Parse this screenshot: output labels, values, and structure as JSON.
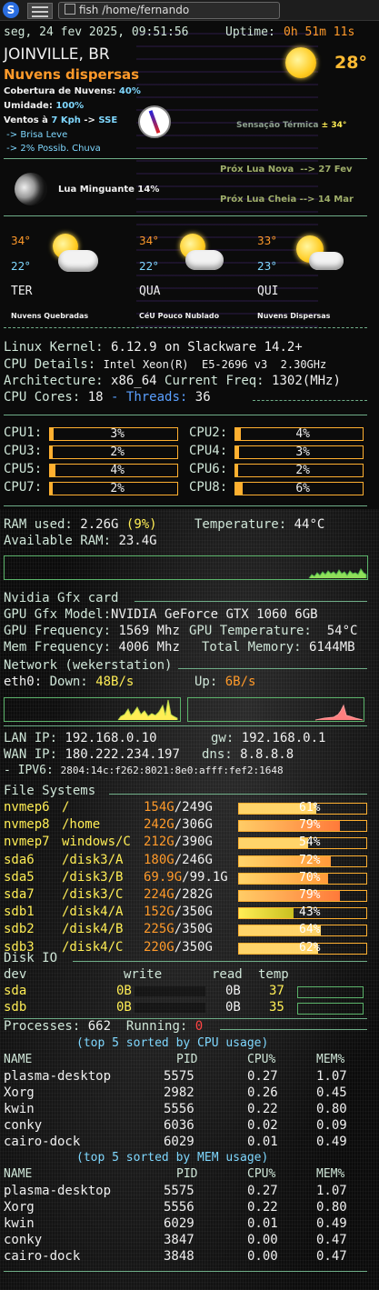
{
  "taskbar": {
    "logo_letter": "S",
    "window_title": "fish /home/fernando"
  },
  "header": {
    "datetime": "seg, 24 fev 2025, 09:51:56",
    "uptime_label": "Uptime:",
    "uptime_value": "0h 51m 11s"
  },
  "weather": {
    "city": "JOINVILLE, BR",
    "temp_now": "28°",
    "condition": "Nuvens dispersas",
    "cloud_label": "Cobertura de Nuvens:",
    "cloud_value": "40%",
    "humidity_label": "Umidade:",
    "humidity_value": "100%",
    "wind_label": "Ventos à",
    "wind_speed": "7 Kph",
    "wind_arrow": "->",
    "wind_dir": "SSE",
    "breeze": " -> Brisa Leve",
    "rain": " -> 2% Possib. Chuva",
    "feels_label": "Sensação Térmica",
    "feels_value": "± 34°",
    "moon_phase": "Lua Minguante 14%",
    "new_moon": "Próx Lua Nova  --> 27 Fev",
    "full_moon": "Próx Lua Cheia --> 14 Mar",
    "forecast": [
      {
        "high": "34°",
        "low": "22°",
        "day": "TER",
        "desc": "Nuvens Quebradas"
      },
      {
        "high": "34°",
        "low": "22°",
        "day": "QUA",
        "desc": "CéU Pouco Nublado"
      },
      {
        "high": "33°",
        "low": "23°",
        "day": "QUI",
        "desc": "Nuvens Dispersas"
      }
    ]
  },
  "system": {
    "kernel_label": "Linux Kernel:",
    "kernel_value": "6.12.9 on Slackware 14.2+",
    "cpu_label": "CPU Details:",
    "cpu_value": "Intel Xeon(R)  E5-2696 v3  2.30GHz",
    "arch_label": "Architecture:",
    "arch_value": "x86_64",
    "freq_label": "Current Freq:",
    "freq_value": "1302(MHz)",
    "cores_label": "CPU Cores:",
    "cores_value": "18",
    "threads_sep": "- Threads:",
    "threads_value": "36"
  },
  "cpus": [
    {
      "name": "CPU1:",
      "pct": 3
    },
    {
      "name": "CPU2:",
      "pct": 4
    },
    {
      "name": "CPU3:",
      "pct": 2
    },
    {
      "name": "CPU4:",
      "pct": 3
    },
    {
      "name": "CPU5:",
      "pct": 4
    },
    {
      "name": "CPU6:",
      "pct": 2
    },
    {
      "name": "CPU7:",
      "pct": 2
    },
    {
      "name": "CPU8:",
      "pct": 6
    }
  ],
  "memory": {
    "ram_label": "RAM used:",
    "ram_value": "2.26G",
    "ram_pct": "(9%)",
    "temp_label": "Temperature:",
    "temp_value": "44°C",
    "avail_label": "Available RAM:",
    "avail_value": "23.4G"
  },
  "gpu": {
    "title": "Nvidia Gfx card",
    "model_label": "GPU Gfx Model:",
    "model_value": "NVIDIA GeForce GTX 1060 6GB",
    "freq_label": "GPU Frequency:",
    "freq_value": "1569 Mhz",
    "temp_label": "GPU Temperature:",
    "temp_value": "54°C",
    "mem_label": "Mem Frequency:",
    "mem_value": "4006 Mhz",
    "total_label": "Total Memory:",
    "total_value": "6144MB"
  },
  "network": {
    "title": "Network (wekerstation)",
    "iface": "eth0:",
    "down_label": "Down:",
    "down_value": "48B/s",
    "up_label": "Up:",
    "up_value": "6B/s",
    "lan_label": "LAN IP:",
    "lan_value": "192.168.0.10",
    "gw_label": "gw:",
    "gw_value": "192.168.0.1",
    "wan_label": "WAN IP:",
    "wan_value": "180.222.234.197",
    "dns_label": "dns:",
    "dns_value": "8.8.8.8",
    "ipv6_label": "- IPV6:",
    "ipv6_value": "2804:14c:f262:8021:8e0:afff:fef2:1648"
  },
  "filesystems": {
    "title": "File Systems",
    "rows": [
      {
        "dev": "nvmep6",
        "mount": "/",
        "used": "154G",
        "size": "249G",
        "pct": 61
      },
      {
        "dev": "nvmep8",
        "mount": "/home",
        "used": "242G",
        "size": "306G",
        "pct": 79
      },
      {
        "dev": "nvmep7",
        "mount": "windows/C",
        "used": "212G",
        "size": "390G",
        "pct": 54
      },
      {
        "dev": "sda6",
        "mount": "/disk3/A",
        "used": "180G",
        "size": "246G",
        "pct": 72
      },
      {
        "dev": "sda5",
        "mount": "/disk3/B",
        "used": "69.9G",
        "size": "99.1G",
        "pct": 70
      },
      {
        "dev": "sda7",
        "mount": "/disk3/C",
        "used": "224G",
        "size": "282G",
        "pct": 79
      },
      {
        "dev": "sdb1",
        "mount": "/disk4/A",
        "used": "152G",
        "size": "350G",
        "pct": 43
      },
      {
        "dev": "sdb2",
        "mount": "/disk4/B",
        "used": "225G",
        "size": "350G",
        "pct": 64
      },
      {
        "dev": "sdb3",
        "mount": "/disk4/C",
        "used": "220G",
        "size": "350G",
        "pct": 62
      }
    ]
  },
  "diskio": {
    "title": "Disk IO",
    "headers": {
      "dev": "dev",
      "write": "write",
      "read": "read",
      "temp": "temp"
    },
    "rows": [
      {
        "dev": "sda",
        "write": "0B",
        "read": "0B",
        "temp": "37"
      },
      {
        "dev": "sdb",
        "write": "0B",
        "read": "0B",
        "temp": "35"
      }
    ]
  },
  "processes": {
    "proc_label": "Processes:",
    "proc_value": "662",
    "running_label": "Running:",
    "running_value": "0",
    "cpu_title": "(top 5 sorted by CPU usage)",
    "mem_title": "(top 5 sorted by MEM usage)",
    "headers": {
      "name": "NAME",
      "pid": "PID",
      "cpu": "CPU%",
      "mem": "MEM%"
    },
    "by_cpu": [
      {
        "name": "plasma-desktop",
        "pid": "5575",
        "cpu": "0.27",
        "mem": "1.07"
      },
      {
        "name": "Xorg",
        "pid": "2982",
        "cpu": "0.26",
        "mem": "0.45"
      },
      {
        "name": "kwin",
        "pid": "5556",
        "cpu": "0.22",
        "mem": "0.80"
      },
      {
        "name": "conky",
        "pid": "6036",
        "cpu": "0.02",
        "mem": "0.09"
      },
      {
        "name": "cairo-dock",
        "pid": "6029",
        "cpu": "0.01",
        "mem": "0.49"
      }
    ],
    "by_mem": [
      {
        "name": "plasma-desktop",
        "pid": "5575",
        "cpu": "0.27",
        "mem": "1.07"
      },
      {
        "name": "Xorg",
        "pid": "5556",
        "cpu": "0.22",
        "mem": "0.80"
      },
      {
        "name": "kwin",
        "pid": "6029",
        "cpu": "0.01",
        "mem": "0.49"
      },
      {
        "name": "conky",
        "pid": "3847",
        "cpu": "0.00",
        "mem": "0.47"
      },
      {
        "name": "cairo-dock",
        "pid": "3848",
        "cpu": "0.00",
        "mem": "0.47"
      }
    ]
  },
  "colors": {
    "label": "#cfe6d8",
    "accent_orange": "#ff9a2a",
    "accent_yellow": "#ffee55",
    "bar_orange": "#ffb030",
    "graph_green": "#5bb36a"
  }
}
